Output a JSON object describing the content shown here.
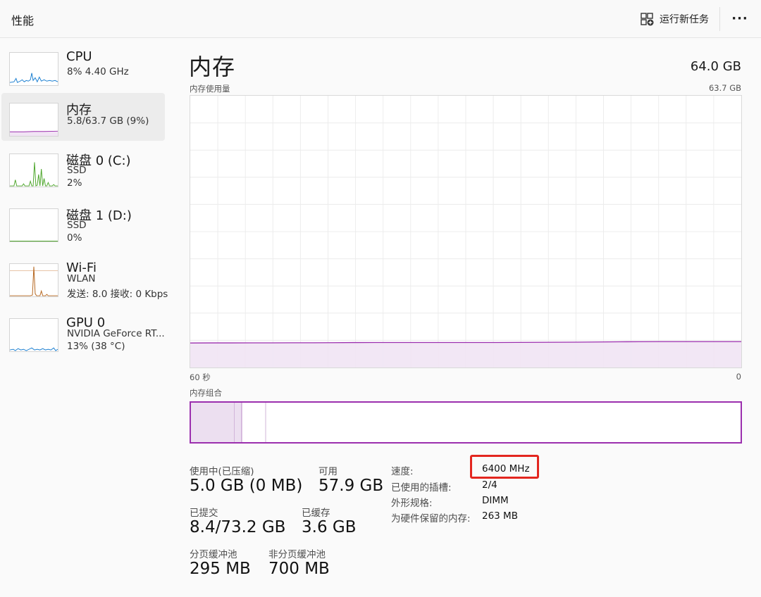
{
  "header": {
    "title": "性能",
    "run_new_task": "运行新任务",
    "more_label": "···"
  },
  "sidebar": {
    "items": [
      {
        "title": "CPU",
        "lines": [
          "8%  4.40 GHz"
        ],
        "graph_color": "#1b7fd1"
      },
      {
        "title": "内存",
        "lines": [
          "5.8/63.7 GB (9%)"
        ],
        "graph_color": "#9b2fae"
      },
      {
        "title": "磁盘 0 (C:)",
        "lines": [
          "SSD",
          "2%"
        ],
        "graph_color": "#4ca52a"
      },
      {
        "title": "磁盘 1 (D:)",
        "lines": [
          "SSD",
          "0%"
        ],
        "graph_color": "#4ca52a"
      },
      {
        "title": "Wi-Fi",
        "lines": [
          "WLAN",
          "发送: 8.0  接收: 0 Kbps"
        ],
        "graph_color": "#b5651d"
      },
      {
        "title": "GPU 0",
        "lines": [
          "NVIDIA GeForce RT...",
          "13%  (38 °C)"
        ],
        "graph_color": "#1b7fd1"
      }
    ]
  },
  "main": {
    "title": "内存",
    "total": "64.0 GB",
    "usage_label": "内存使用量",
    "usage_max": "63.7 GB",
    "time_left": "60 秒",
    "time_right": "0",
    "composition_label": "内存组合",
    "accent": "#9b2fae",
    "stats": {
      "in_use_label": "使用中(已压缩)",
      "in_use_value": "5.0 GB (0 MB)",
      "available_label": "可用",
      "available_value": "57.9 GB",
      "committed_label": "已提交",
      "committed_value": "8.4/73.2 GB",
      "cached_label": "已缓存",
      "cached_value": "3.6 GB",
      "paged_label": "分页缓冲池",
      "paged_value": "295 MB",
      "nonpaged_label": "非分页缓冲池",
      "nonpaged_value": "700 MB"
    },
    "specs": {
      "speed_label": "速度:",
      "speed_value": "6400 MHz",
      "slots_label": "已使用的插槽:",
      "slots_value": "2/4",
      "form_label": "外形规格:",
      "form_value": "DIMM",
      "reserved_label": "为硬件保留的内存:",
      "reserved_value": "263 MB"
    }
  },
  "chart_data": {
    "type": "area",
    "title": "内存使用量",
    "xlabel": "",
    "ylabel": "",
    "x_tick_labels": [
      "60 秒",
      "0"
    ],
    "y_max_label": "63.7 GB",
    "xlim": [
      60,
      0
    ],
    "ylim": [
      0,
      63.7
    ],
    "series": [
      {
        "values": [
          5.75,
          5.76,
          5.77,
          5.78,
          5.78,
          5.79,
          5.8,
          5.82,
          5.85,
          5.86,
          5.86,
          5.86,
          5.86,
          5.86,
          5.86,
          5.86,
          5.87,
          5.9,
          5.92,
          5.94,
          5.98,
          6.02,
          6.04,
          6.05,
          6.06,
          6.06,
          6.06,
          6.06
        ]
      }
    ],
    "color": "#9b2fae"
  }
}
